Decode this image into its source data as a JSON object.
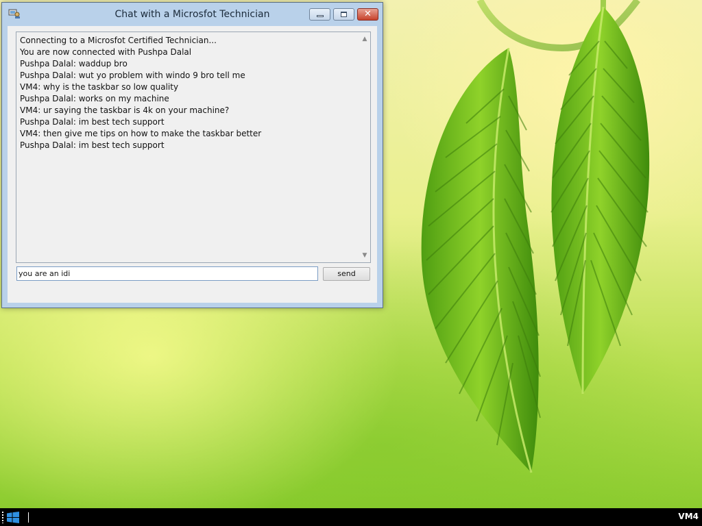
{
  "window": {
    "title": "Chat with a Microsfot Technician",
    "icon": "chat-app-icon",
    "controls": {
      "minimize": "minimize-icon",
      "maximize": "maximize-icon",
      "close_label": "✕"
    }
  },
  "chat": {
    "lines": [
      "Connecting to a Microsfot Certified Technician...",
      "You are now connected with Pushpa Dalal",
      "Pushpa Dalal: waddup bro",
      "Pushpa Dalal: wut yo problem with windo 9 bro tell me",
      "VM4: why is the taskbar so low quality",
      "Pushpa Dalal: works on my machine",
      "VM4: ur saying the taskbar is 4k on your machine?",
      "Pushpa Dalal: im best tech support",
      "VM4: then give me tips on how to make the taskbar better",
      "Pushpa Dalal: im best tech support"
    ],
    "scroll_up": "▲",
    "scroll_down": "▼"
  },
  "input": {
    "value": "you are an idi"
  },
  "buttons": {
    "send_label": "send"
  },
  "taskbar": {
    "start_icon": "windows-logo-icon",
    "machine_label": "VM4"
  }
}
